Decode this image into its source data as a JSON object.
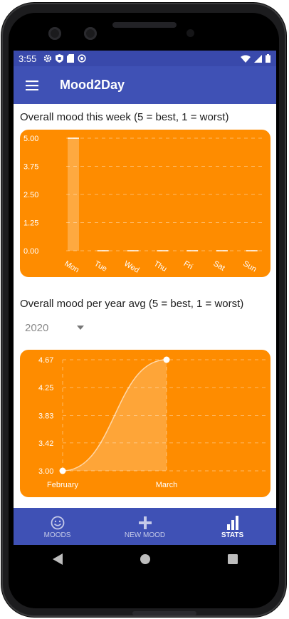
{
  "status": {
    "time": "3:55"
  },
  "appbar": {
    "title": "Mood2Day"
  },
  "week_section": {
    "title": "Overall mood this week (5 = best, 1 = worst)"
  },
  "year_section": {
    "title": "Overall mood per year avg (5 = best, 1 = worst)",
    "selected_year": "2020"
  },
  "nav": {
    "items": [
      {
        "label": "MOODS",
        "icon": "smiley-icon"
      },
      {
        "label": "NEW MOOD",
        "icon": "plus-icon"
      },
      {
        "label": "STATS",
        "icon": "bar-chart-icon"
      }
    ],
    "active": "STATS"
  },
  "colors": {
    "appbar": "#3f51b5",
    "statusbar": "#3949ab",
    "chart": "#fe8c00"
  },
  "chart_data": [
    {
      "type": "bar",
      "categories": [
        "Mon",
        "Tue",
        "Wed",
        "Thu",
        "Fri",
        "Sat",
        "Sun"
      ],
      "values": [
        5,
        0,
        0,
        0,
        0,
        0,
        0
      ],
      "ylim": [
        0,
        5
      ],
      "yticks": [
        "0.00",
        "1.25",
        "2.50",
        "3.75",
        "5.00"
      ],
      "grid": true
    },
    {
      "type": "area",
      "categories": [
        "February",
        "March"
      ],
      "values": [
        3.0,
        4.67
      ],
      "ylim": [
        3.0,
        4.67
      ],
      "yticks": [
        "3.00",
        "3.42",
        "3.83",
        "4.25",
        "4.67"
      ],
      "grid": true
    }
  ]
}
